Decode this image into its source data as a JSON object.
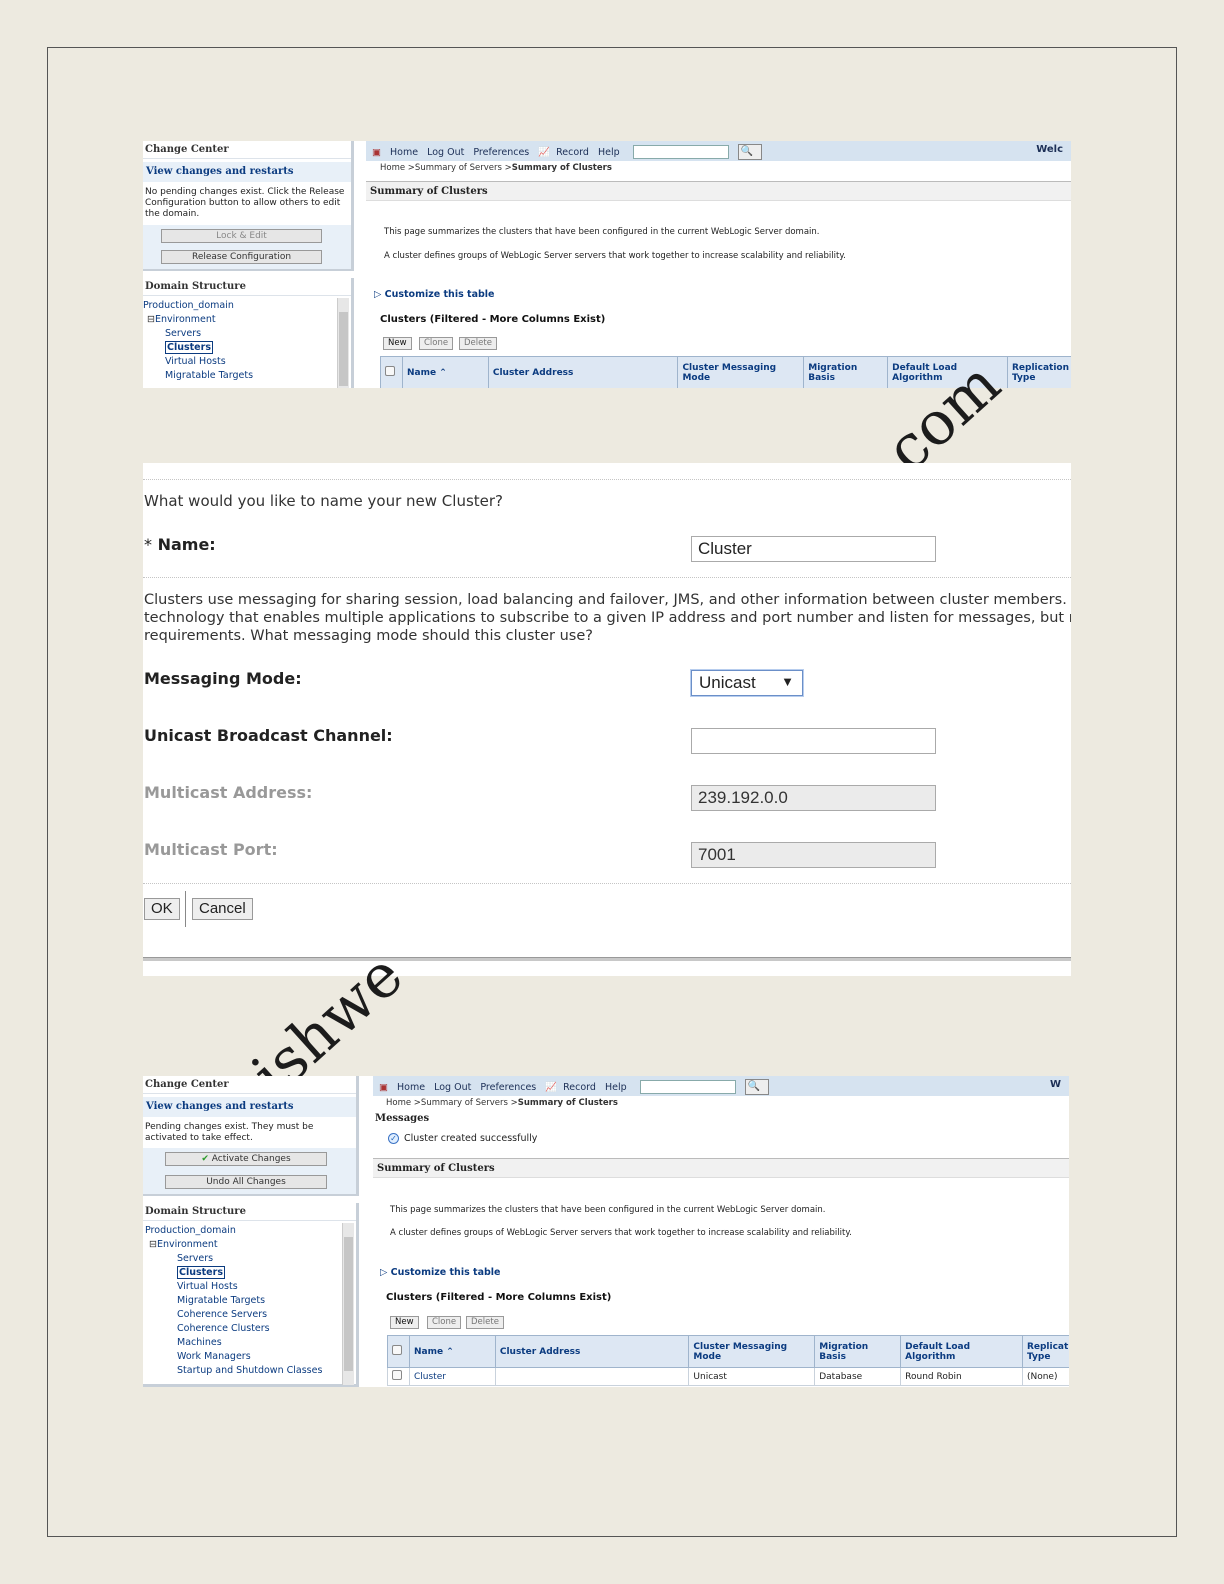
{
  "shot1": {
    "change_center": {
      "title": "Change Center",
      "link": "View changes and restarts",
      "message": "No pending changes exist. Click the Release Configuration button to allow others to edit the domain.",
      "lock_button": "Lock & Edit",
      "release_button": "Release Configuration"
    },
    "domain_structure": {
      "title": "Domain Structure",
      "items": [
        "Production_domain",
        "Environment",
        "Servers",
        "Clusters",
        "Virtual Hosts",
        "Migratable Targets"
      ]
    },
    "nav": {
      "home": "Home",
      "logout": "Log Out",
      "preferences": "Preferences",
      "record": "Record",
      "help": "Help",
      "welcome": "Welc"
    },
    "breadcrumb": "Home >Summary of Servers >",
    "breadcrumb_current": "Summary of Clusters",
    "section_title": "Summary of Clusters",
    "para1": "This page summarizes the clusters that have been configured in the current WebLogic Server domain.",
    "para2": "A cluster defines groups of WebLogic Server servers that work together to increase scalability and reliability.",
    "customize": "Customize this table",
    "table_caption": "Clusters (Filtered - More Columns Exist)",
    "buttons": {
      "new": "New",
      "clone": "Clone",
      "delete": "Delete"
    },
    "columns": [
      "Name",
      "Cluster Address",
      "Cluster Messaging Mode",
      "Migration Basis",
      "Default Load Algorithm",
      "Replication Type"
    ]
  },
  "shot2": {
    "question": "What would you like to name your new Cluster?",
    "name_label": "Name:",
    "name_required": "*",
    "name_value": "Cluster",
    "description_line1": "Clusters use messaging for sharing session, load balancing and failover, JMS, and other information between cluster members. Clusters c",
    "description_line2": "technology that enables multiple applications to subscribe to a given IP address and port number and listen for messages, but requires h",
    "description_line3": "requirements. What messaging mode should this cluster use?",
    "messaging_mode_label": "Messaging Mode:",
    "messaging_mode_value": "Unicast",
    "unicast_channel_label": "Unicast Broadcast Channel:",
    "unicast_channel_value": "",
    "multicast_address_label": "Multicast Address:",
    "multicast_address_value": "239.192.0.0",
    "multicast_port_label": "Multicast Port:",
    "multicast_port_value": "7001",
    "ok_button": "OK",
    "cancel_button": "Cancel"
  },
  "shot3": {
    "change_center": {
      "title": "Change Center",
      "link": "View changes and restarts",
      "message": "Pending changes exist. They must be activated to take effect.",
      "activate_button": "Activate Changes",
      "undo_button": "Undo All Changes"
    },
    "domain_structure": {
      "title": "Domain Structure",
      "items": [
        "Production_domain",
        "Environment",
        "Servers",
        "Clusters",
        "Virtual Hosts",
        "Migratable Targets",
        "Coherence Servers",
        "Coherence Clusters",
        "Machines",
        "Work Managers",
        "Startup and Shutdown Classes"
      ]
    },
    "nav": {
      "home": "Home",
      "logout": "Log Out",
      "preferences": "Preferences",
      "record": "Record",
      "help": "Help",
      "welcome": "W"
    },
    "breadcrumb": "Home >Summary of Servers >",
    "breadcrumb_current": "Summary of Clusters",
    "messages_label": "Messages",
    "message_ok": "Cluster created successfully",
    "section_title": "Summary of Clusters",
    "para1": "This page summarizes the clusters that have been configured in the current WebLogic Server domain.",
    "para2": "A cluster defines groups of WebLogic Server servers that work together to increase scalability and reliability.",
    "customize": "Customize this table",
    "table_caption": "Clusters (Filtered - More Columns Exist)",
    "buttons": {
      "new": "New",
      "clone": "Clone",
      "delete": "Delete"
    },
    "columns": [
      "Name",
      "Cluster Address",
      "Cluster Messaging Mode",
      "Migration Basis",
      "Default Load Algorithm",
      "Replicat Type"
    ],
    "row": {
      "name": "Cluster",
      "address": "",
      "mode": "Unicast",
      "basis": "Database",
      "algorithm": "Round Robin",
      "replication": "(None)"
    }
  },
  "watermark": {
    "top": "com",
    "bottom": "ishwe"
  }
}
